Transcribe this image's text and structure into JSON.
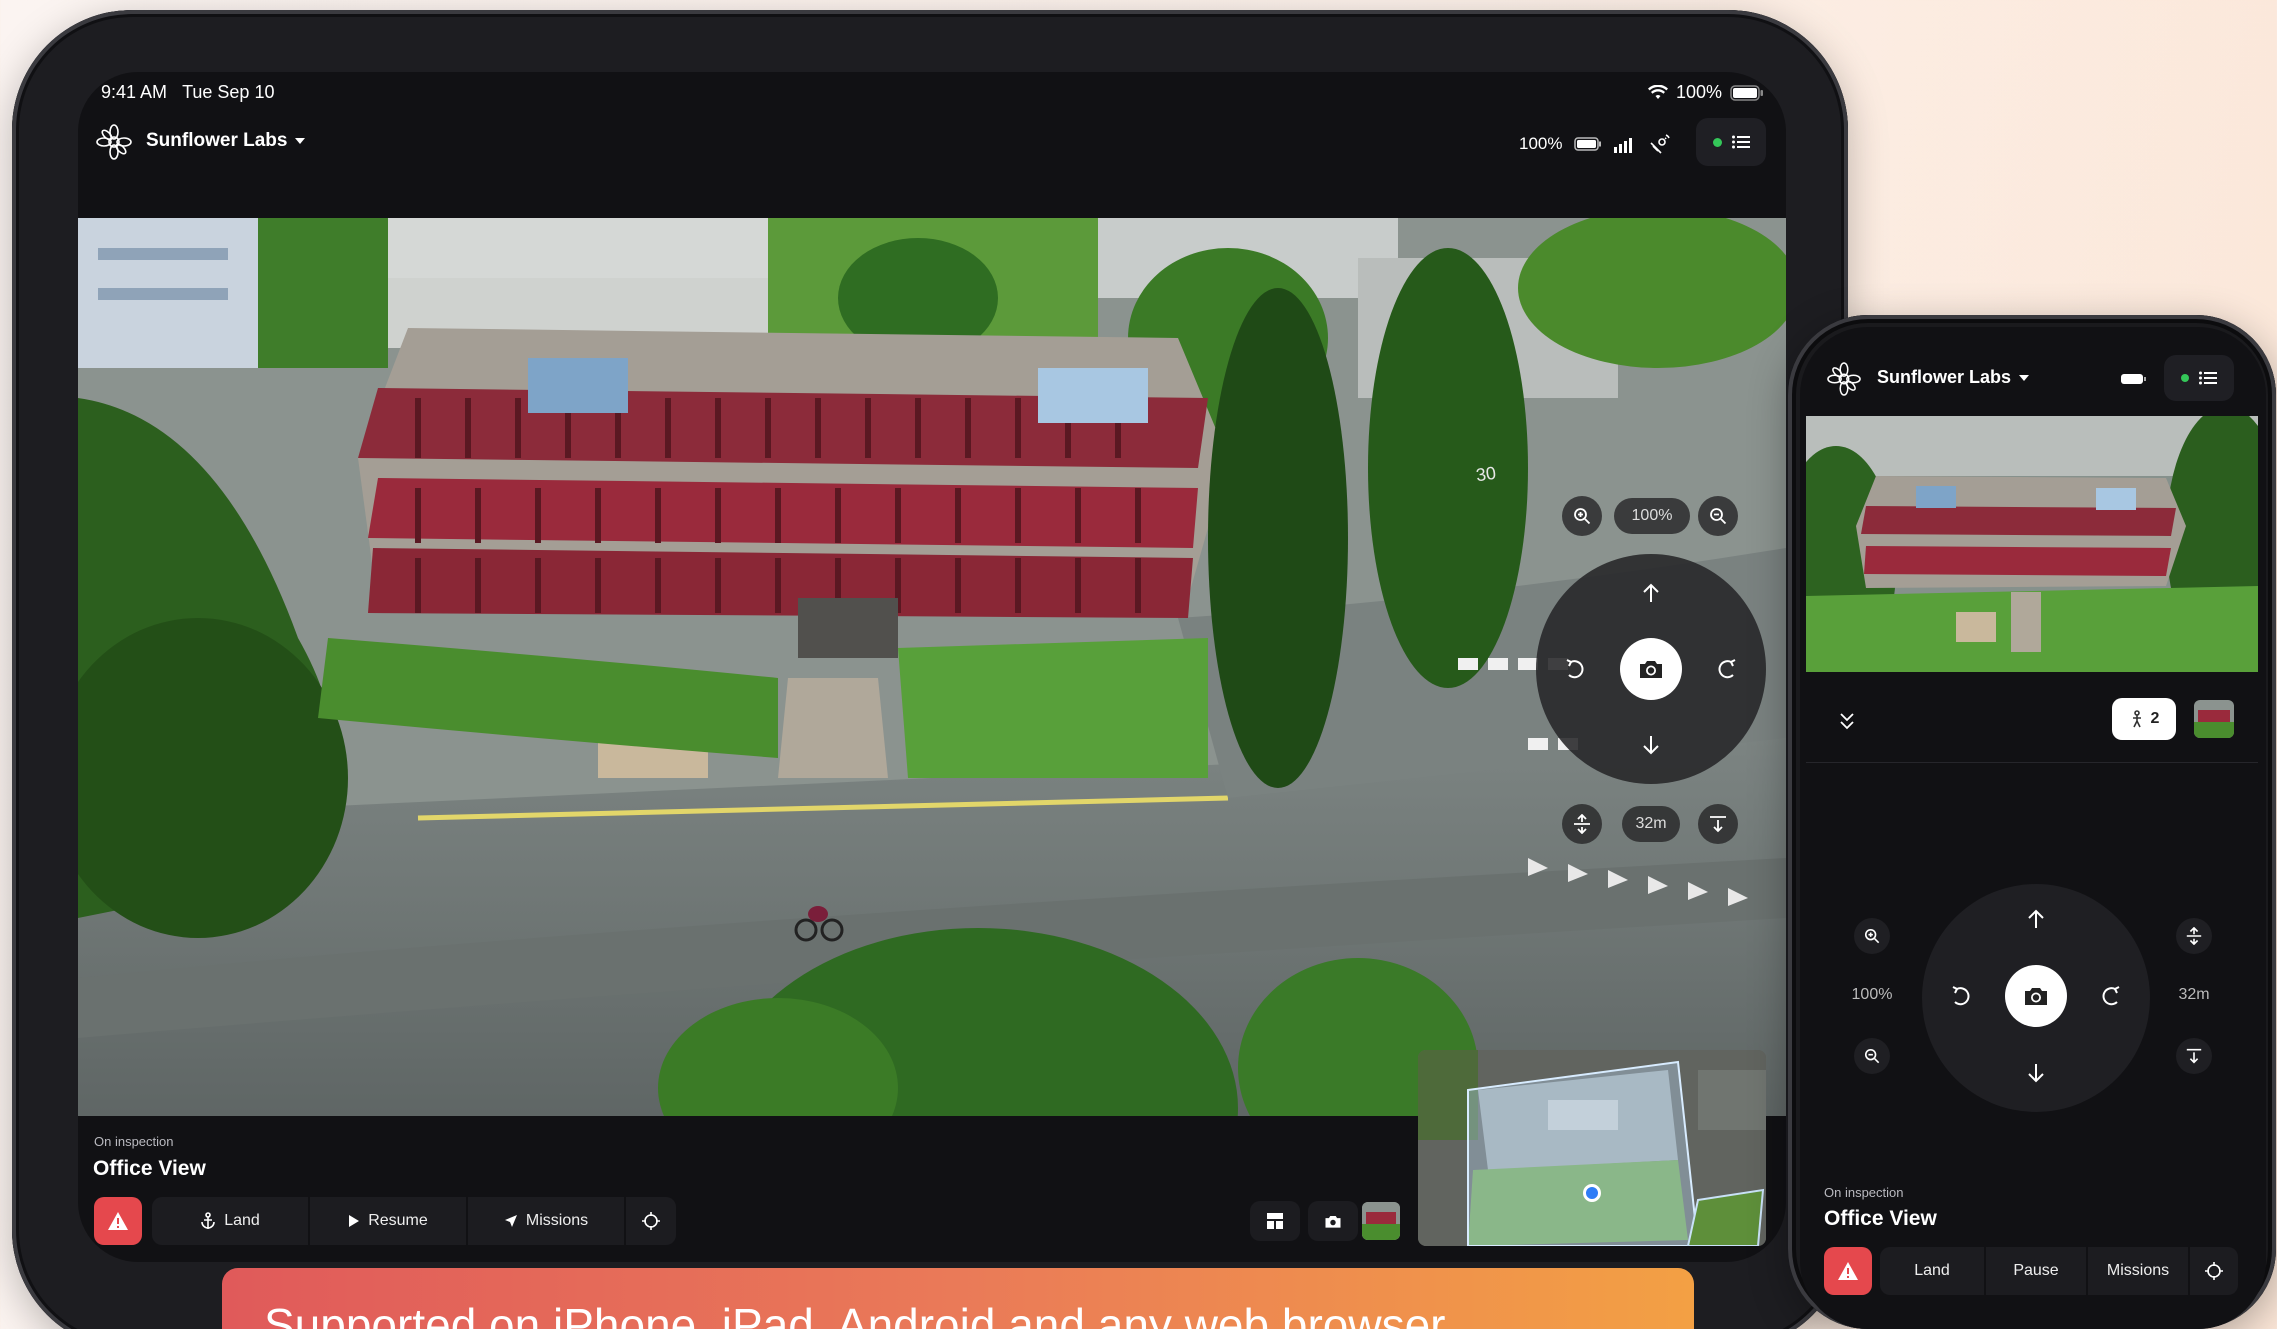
{
  "tablet": {
    "status_bar": {
      "time": "9:41 AM",
      "date": "Tue Sep 10",
      "battery": "100%"
    },
    "header": {
      "org_name": "Sunflower Labs",
      "drone_battery": "100%"
    },
    "video": {
      "zoom": "100%",
      "altitude": "32m",
      "road_marking": "30"
    },
    "inspection": {
      "label": "On inspection",
      "title": "Office View"
    },
    "actions": {
      "land": "Land",
      "resume": "Resume",
      "missions": "Missions"
    }
  },
  "phone": {
    "header": {
      "org_name": "Sunflower Labs"
    },
    "people_count": "2",
    "zoom": "100%",
    "altitude": "32m",
    "inspection": {
      "label": "On inspection",
      "title": "Office View"
    },
    "actions": {
      "land": "Land",
      "pause": "Pause",
      "missions": "Missions"
    }
  },
  "banner": {
    "text": "Supported on iPhone, iPad, Android and any web browser"
  },
  "colors": {
    "alert": "#e5484d",
    "status_dot": "#34c759",
    "banner_start": "#e05a5a",
    "banner_end": "#f3a044"
  },
  "icons": [
    "sunflower-logo-icon",
    "wifi-icon",
    "battery-icon",
    "signal-icon",
    "gps-icon",
    "list-icon",
    "zoom-in-icon",
    "zoom-out-icon",
    "arrow-up-icon",
    "arrow-down-icon",
    "rotate-left-icon",
    "rotate-right-icon",
    "camera-icon",
    "ascend-icon",
    "descend-icon",
    "alert-icon",
    "anchor-icon",
    "play-icon",
    "navigation-icon",
    "crosshair-icon",
    "layout-icon",
    "chevrons-down-icon",
    "person-icon"
  ]
}
